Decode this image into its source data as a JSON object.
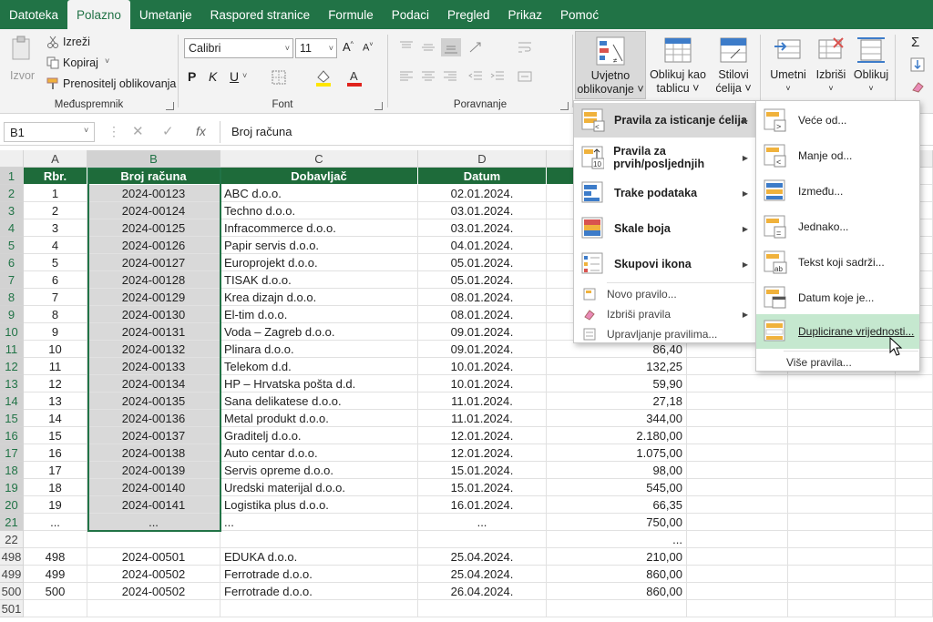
{
  "tabs": [
    "Datoteka",
    "Polazno",
    "Umetanje",
    "Raspored stranice",
    "Formule",
    "Podaci",
    "Pregled",
    "Prikaz",
    "Pomoć"
  ],
  "active_tab": "Polazno",
  "ribbon": {
    "clipboard": {
      "paste": "Izvor",
      "cut": "Izreži",
      "copy": "Kopiraj",
      "format_painter": "Prenositelj oblikovanja",
      "group": "Međuspremnik"
    },
    "font": {
      "name": "Calibri",
      "size": "11",
      "bold": "P",
      "italic": "K",
      "underline": "U",
      "font_color": "A",
      "group": "Font"
    },
    "alignment": {
      "group": "Poravnanje"
    },
    "styles": {
      "conditional": [
        "Uvjetno",
        "oblikovanje ˅"
      ],
      "table": [
        "Oblikuj kao",
        "tablicu ˅"
      ],
      "cell_styles": [
        "Stilovi",
        "ćelija ˅"
      ]
    },
    "cells": {
      "insert": "Umetni",
      "delete": "Izbriši",
      "format": "Oblikuj"
    }
  },
  "formula_bar": {
    "name_box": "B1",
    "fx": "fx",
    "content": "Broj računa"
  },
  "columns": [
    "A",
    "B",
    "C",
    "D"
  ],
  "row_numbers": [
    "1",
    "2",
    "3",
    "4",
    "5",
    "6",
    "7",
    "8",
    "9",
    "10",
    "11",
    "12",
    "13",
    "14",
    "15",
    "16",
    "17",
    "18",
    "19",
    "20",
    "21",
    "22",
    "498",
    "499",
    "500",
    "501"
  ],
  "header": {
    "a": "Rbr.",
    "b": "Broj računa",
    "c": "Dobavljač",
    "d": "Datum"
  },
  "rows": [
    {
      "a": "1",
      "b": "2024-00123",
      "c": "ABC d.o.o.",
      "d": "02.01.2024.",
      "e": ""
    },
    {
      "a": "2",
      "b": "2024-00124",
      "c": "Techno d.o.o.",
      "d": "03.01.2024.",
      "e": ""
    },
    {
      "a": "3",
      "b": "2024-00125",
      "c": "Infracommerce d.o.o.",
      "d": "03.01.2024.",
      "e": ""
    },
    {
      "a": "4",
      "b": "2024-00126",
      "c": "Papir servis d.o.o.",
      "d": "04.01.2024.",
      "e": ""
    },
    {
      "a": "5",
      "b": "2024-00127",
      "c": "Europrojekt d.o.o.",
      "d": "05.01.2024.",
      "e": ""
    },
    {
      "a": "6",
      "b": "2024-00128",
      "c": "TISAK d.o.o.",
      "d": "05.01.2024.",
      "e": ""
    },
    {
      "a": "7",
      "b": "2024-00129",
      "c": "Krea dizajn d.o.o.",
      "d": "08.01.2024.",
      "e": ""
    },
    {
      "a": "8",
      "b": "2024-00130",
      "c": "El-tim d.o.o.",
      "d": "08.01.2024.",
      "e": ""
    },
    {
      "a": "9",
      "b": "2024-00131",
      "c": "Voda – Zagreb d.o.o.",
      "d": "09.01.2024.",
      "e": ""
    },
    {
      "a": "10",
      "b": "2024-00132",
      "c": "Plinara d.o.o.",
      "d": "09.01.2024.",
      "e": "86,40"
    },
    {
      "a": "11",
      "b": "2024-00133",
      "c": "Telekom d.d.",
      "d": "10.01.2024.",
      "e": "132,25"
    },
    {
      "a": "12",
      "b": "2024-00134",
      "c": "HP – Hrvatska pošta d.d.",
      "d": "10.01.2024.",
      "e": "59,90"
    },
    {
      "a": "13",
      "b": "2024-00135",
      "c": "Sana delikatese d.o.o.",
      "d": "11.01.2024.",
      "e": "27,18"
    },
    {
      "a": "14",
      "b": "2024-00136",
      "c": "Metal produkt d.o.o.",
      "d": "11.01.2024.",
      "e": "344,00"
    },
    {
      "a": "15",
      "b": "2024-00137",
      "c": "Graditelj d.o.o.",
      "d": "12.01.2024.",
      "e": "2.180,00"
    },
    {
      "a": "16",
      "b": "2024-00138",
      "c": "Auto centar d.o.o.",
      "d": "12.01.2024.",
      "e": "1.075,00"
    },
    {
      "a": "17",
      "b": "2024-00139",
      "c": "Servis opreme d.o.o.",
      "d": "15.01.2024.",
      "e": "98,00"
    },
    {
      "a": "18",
      "b": "2024-00140",
      "c": "Uredski materijal d.o.o.",
      "d": "15.01.2024.",
      "e": "545,00"
    },
    {
      "a": "19",
      "b": "2024-00141",
      "c": "Logistika plus d.o.o.",
      "d": "16.01.2024.",
      "e": "66,35"
    },
    {
      "a": "...",
      "b": "...",
      "c": "...",
      "d": "...",
      "e": "750,00"
    },
    {
      "a": "",
      "b": "",
      "c": "",
      "d": "",
      "e": "..."
    },
    {
      "a": "498",
      "b": "2024-00501",
      "c": "EDUKA d.o.o.",
      "d": "25.04.2024.",
      "e": "210,00"
    },
    {
      "a": "499",
      "b": "2024-00502",
      "c": "Ferrotrade d.o.o.",
      "d": "25.04.2024.",
      "e": "860,00"
    },
    {
      "a": "500",
      "b": "2024-00502",
      "c": "Ferrotrade d.o.o.",
      "d": "26.04.2024.",
      "e": "860,00"
    }
  ],
  "menu": {
    "items": [
      "Pravila za isticanje ćelija",
      "Pravila za prvih/posljednjih",
      "Trake podataka",
      "Skale boja",
      "Skupovi ikona"
    ],
    "small": [
      "Novo pravilo...",
      "Izbriši pravila",
      "Upravljanje pravilima..."
    ]
  },
  "submenu": {
    "items": [
      "Veće od...",
      "Manje od...",
      "Između...",
      "Jednako...",
      "Tekst koji sadrži...",
      "Datum koje je...",
      "Duplicirane vrijednosti..."
    ],
    "more": "Više pravila..."
  },
  "colors": {
    "accent": "#217346",
    "header_fill": "#1e6b3a",
    "highlight": "#c5e8cf"
  }
}
